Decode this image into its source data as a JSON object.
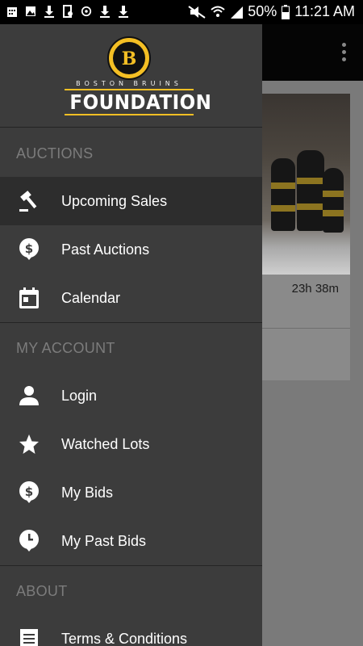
{
  "status_bar": {
    "battery": "50%",
    "time": "11:21 AM"
  },
  "app": {
    "card_time_left": "23h 38m"
  },
  "drawer": {
    "logo": {
      "top_text": "BOSTON BRUINS",
      "main_text": "FOUNDATION",
      "emblem_letter": "B"
    },
    "sections": [
      {
        "label": "AUCTIONS",
        "items": [
          {
            "label": "Upcoming Sales",
            "icon": "gavel-icon",
            "active": true
          },
          {
            "label": "Past Auctions",
            "icon": "dollar-bubble-icon"
          },
          {
            "label": "Calendar",
            "icon": "calendar-icon"
          }
        ]
      },
      {
        "label": "MY ACCOUNT",
        "items": [
          {
            "label": "Login",
            "icon": "person-icon"
          },
          {
            "label": "Watched Lots",
            "icon": "star-icon"
          },
          {
            "label": "My Bids",
            "icon": "dollar-bubble-icon"
          },
          {
            "label": "My Past Bids",
            "icon": "clock-bubble-icon"
          }
        ]
      },
      {
        "label": "ABOUT",
        "items": [
          {
            "label": "Terms & Conditions",
            "icon": "document-icon"
          }
        ]
      }
    ]
  },
  "colors": {
    "drawer_bg": "#3c3c3c",
    "active_item_bg": "#2d2d2d",
    "section_label": "#7c7c7c",
    "brand_gold": "#f4bf24"
  }
}
